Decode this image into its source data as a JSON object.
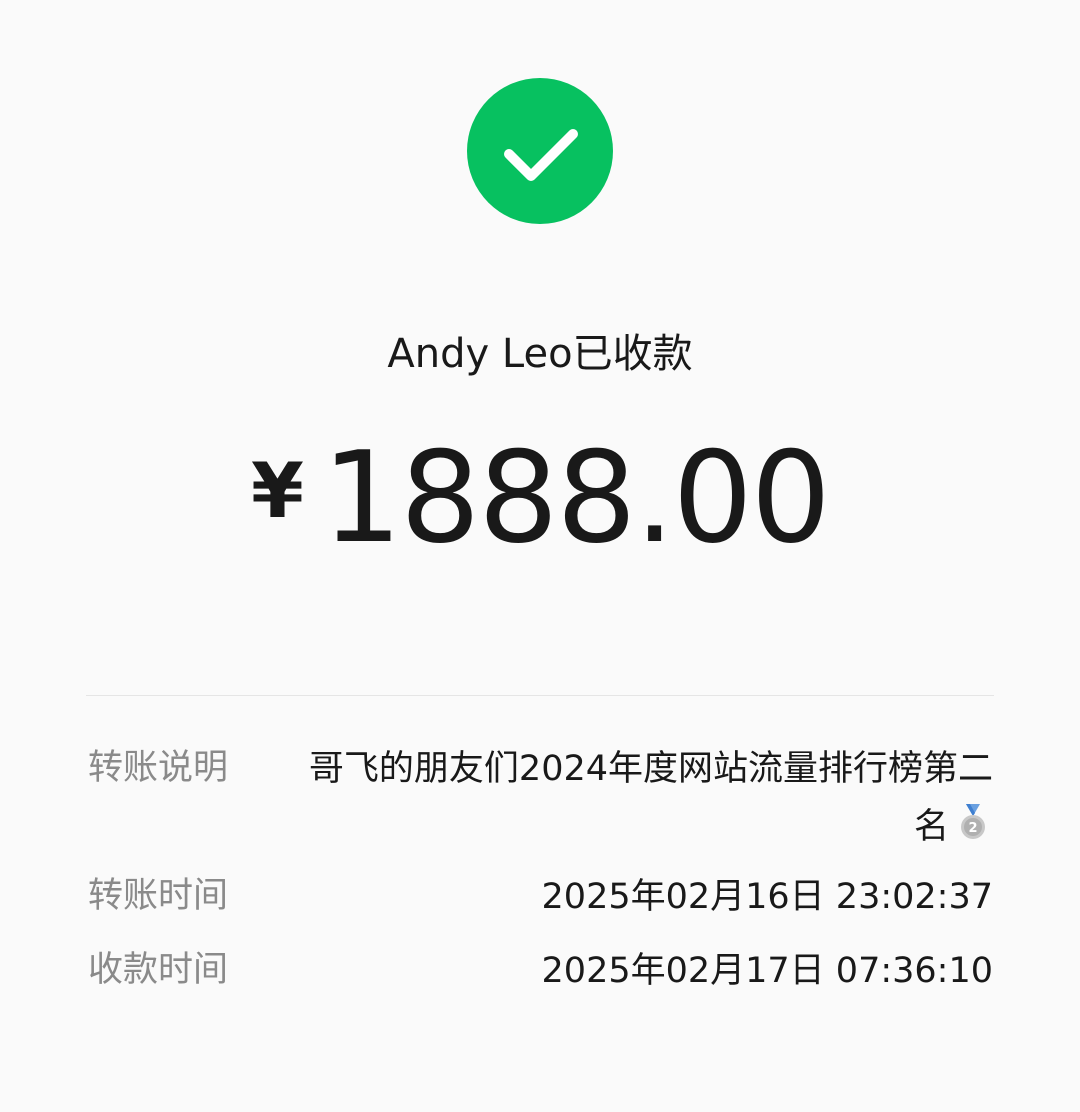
{
  "status": {
    "icon": "check-circle-icon",
    "color": "#07c160"
  },
  "receiver_text": "Andy Leo已收款",
  "amount": {
    "currency": "¥",
    "value": "1888.00"
  },
  "details": {
    "description_label": "转账说明",
    "description_value": "哥飞的朋友们2024年度网站流量排行榜第二名",
    "description_emoji": "second-place-medal-icon",
    "send_time_label": "转账时间",
    "send_time_value": "2025年02月16日 23:02:37",
    "receive_time_label": "收款时间",
    "receive_time_value": "2025年02月17日 07:36:10"
  }
}
